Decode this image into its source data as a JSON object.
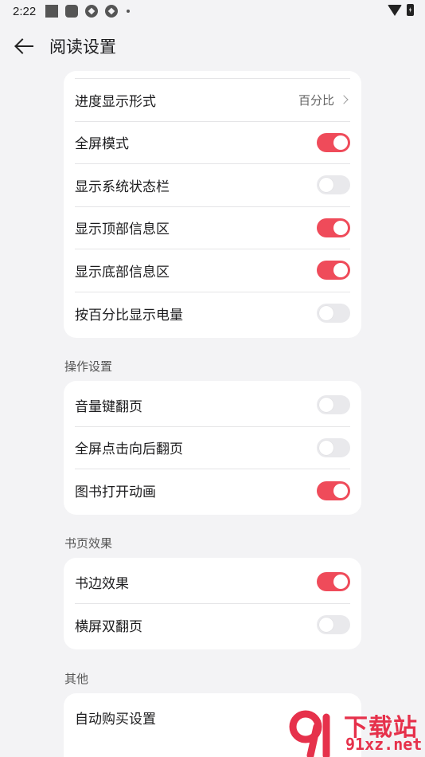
{
  "status_bar": {
    "time": "2:22"
  },
  "header": {
    "title": "阅读设置"
  },
  "group_display": {
    "rows": [
      {
        "label": "进度显示形式",
        "value": "百分比"
      },
      {
        "label": "全屏模式",
        "on": true
      },
      {
        "label": "显示系统状态栏",
        "on": false
      },
      {
        "label": "显示顶部信息区",
        "on": true
      },
      {
        "label": "显示底部信息区",
        "on": true
      },
      {
        "label": "按百分比显示电量",
        "on": false
      }
    ]
  },
  "group_operation": {
    "title": "操作设置",
    "rows": [
      {
        "label": "音量键翻页",
        "on": false
      },
      {
        "label": "全屏点击向后翻页",
        "on": false
      },
      {
        "label": "图书打开动画",
        "on": true
      }
    ]
  },
  "group_page_effect": {
    "title": "书页效果",
    "rows": [
      {
        "label": "书边效果",
        "on": true
      },
      {
        "label": "横屏双翻页",
        "on": false
      }
    ]
  },
  "group_other": {
    "title": "其他",
    "rows": [
      {
        "label": "自动购买设置"
      }
    ]
  },
  "watermark": {
    "top": "下载站",
    "bottom": "91xz.net"
  },
  "colors": {
    "accent": "#ef4b5a",
    "toggle_off": "#e9e9ec",
    "background": "#f3f3f5"
  }
}
